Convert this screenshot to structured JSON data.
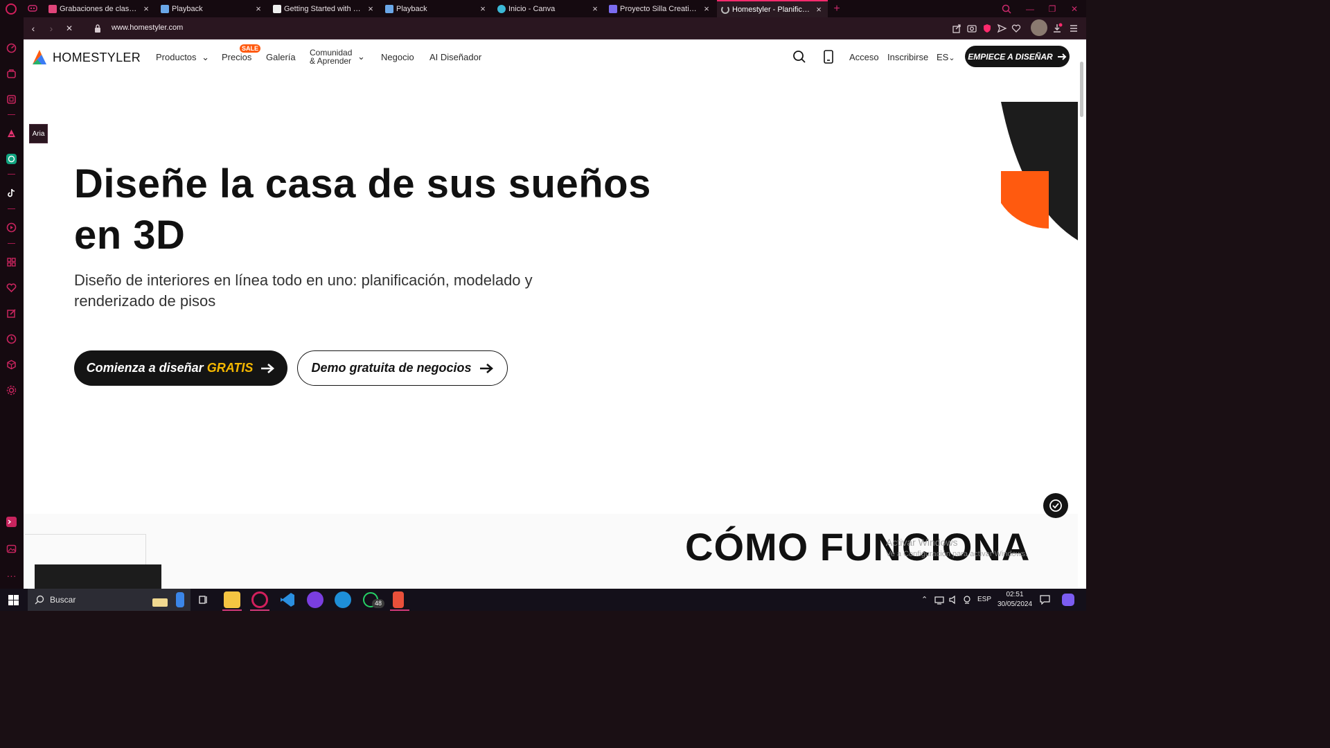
{
  "browser": {
    "tabs": [
      {
        "title": "Grabaciones de clases ante",
        "icon": "tlb-icon"
      },
      {
        "title": "Playback",
        "icon": "playback-icon"
      },
      {
        "title": "Getting Started with Enterp",
        "icon": "github-icon"
      },
      {
        "title": "Playback",
        "icon": "playback-icon"
      },
      {
        "title": "Inicio - Canva",
        "icon": "canva-icon"
      },
      {
        "title": "Proyecto Silla Creativa - Pr",
        "icon": "project-icon"
      },
      {
        "title": "Homestyler - Planificador d",
        "icon": "loading-icon",
        "active": true
      }
    ],
    "url": "www.homestyler.com",
    "accent_color": "#ff2a6d"
  },
  "sidebar": {
    "aria_label": "Aria"
  },
  "site": {
    "brand": "HOMESTYLER",
    "nav": {
      "productos": "Productos",
      "precios": "Precios",
      "sale_badge": "SALE",
      "galeria": "Galería",
      "comunidad_line1": "Comunidad",
      "comunidad_line2": "& Aprender",
      "negocio": "Negocio",
      "ai": "AI Diseñador"
    },
    "header_right": {
      "login": "Acceso",
      "signup": "Inscribirse",
      "lang": "ES",
      "cta": "EMPIECE A DISEÑAR"
    },
    "hero": {
      "title_line1": "Diseñe la casa de sus sueños",
      "title_line2": "en 3D",
      "subtitle_line1": "Diseño de interiores en línea todo en uno: planificación, modelado y",
      "subtitle_line2": "renderizado de pisos",
      "primary_prefix": "Comienza a diseñar ",
      "primary_highlight": "GRATIS",
      "secondary": "Demo gratuita de negocios"
    },
    "section_title": "CÓMO FUNCIONA",
    "watermark_line1": "Activar Windows",
    "watermark_line2": "Ve a Configuración para activar Windows.",
    "colors": {
      "highlight": "#f5b800",
      "orange": "#ff5a0f",
      "dark": "#141414"
    }
  },
  "taskbar": {
    "search_placeholder": "Buscar",
    "whatsapp_badge": "48",
    "lang": "ESP",
    "time": "02:51",
    "date": "30/05/2024"
  }
}
